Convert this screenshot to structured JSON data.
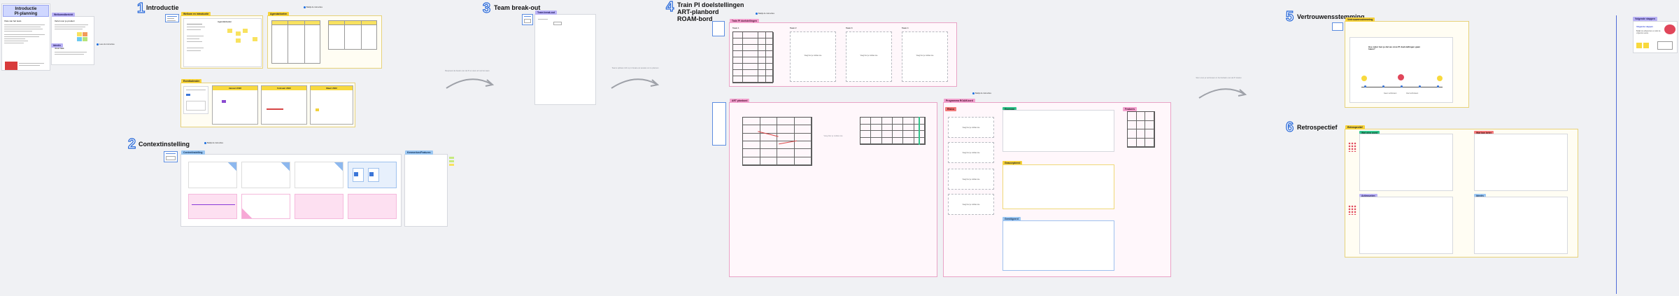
{
  "intro": {
    "title_line1": "Introductie",
    "title_line2": "PI-planning",
    "vision_label": "Visie van het team",
    "card_label": "Welkomstbericht",
    "section1_label": "Vertel over je product",
    "section2_label": "Jouw taak"
  },
  "steps": {
    "s1": {
      "num": "1",
      "title": "Introductie"
    },
    "s2": {
      "num": "2",
      "title": "Contextinstelling"
    },
    "s3": {
      "num": "3",
      "title": "Team break-out"
    },
    "s4": {
      "num": "4",
      "title_line1": "Train PI doelstellingen",
      "title_line2": "ART-planbord",
      "title_line3": "ROAM-bord"
    },
    "s5": {
      "num": "5",
      "title": "Vertrouwensstemming"
    },
    "s6": {
      "num": "6",
      "title": "Retrospectief"
    }
  },
  "tags": {
    "welcome": "Welkom en introductie",
    "agenda": "Agenda/doelen",
    "calendar": "Eventkalender",
    "context": "Contextinstelling",
    "keyfeatures": "Kenmerken/Features",
    "breakout": "Team break-out",
    "train_goals": "Train PI doelstellingen",
    "art_board": "ART planbord",
    "roam": "Programma ROAM-bord",
    "risk": "Risico",
    "owned": "Eigenaar",
    "accepted": "Geaccepteerd",
    "mitigated": "Gemitigeerd",
    "features": "Features",
    "confidence": "Vertrouwensstemming",
    "retro": "Retrospectief",
    "went_well": "Wat ging goed",
    "improve": "Wat kan beter",
    "actions": "Actiepunten",
    "ideas": "Ideeën",
    "next_steps": "Volgende stappen"
  },
  "labels": {
    "team1": "Team 1",
    "team2": "Team 2",
    "team3": "Team 3",
    "team4": "Team 4",
    "dummy_sticky": "Voeg hier je notities toe",
    "cal_month1": "Januari 2022",
    "cal_month2": "Februari 2022",
    "cal_month3": "Maart 2022",
    "connector1": "Bespreek de doelen van de PI en stem af met het team",
    "connector2": "Teams splitsen zich op in break-out sessies om te plannen",
    "connector3": "Stem over je vertrouwen in het behalen van de PI doelen",
    "confidence_question": "Hoe zeker ben je dat we onze PI doelstellingen gaan halen?",
    "scale_low": "Geen vertrouwen",
    "scale_high": "Veel vertrouwen",
    "next_title": "Volgende stappen",
    "next_text": "Bekijk de actiepunten en plan de volgende sessie"
  },
  "help": {
    "h1": "Lees de instructies",
    "h2": "Bekijk de instructies",
    "h3": "Bekijk de instructies",
    "h4": "Bekijk de instructies",
    "h5": "Bekijk de instructies"
  }
}
